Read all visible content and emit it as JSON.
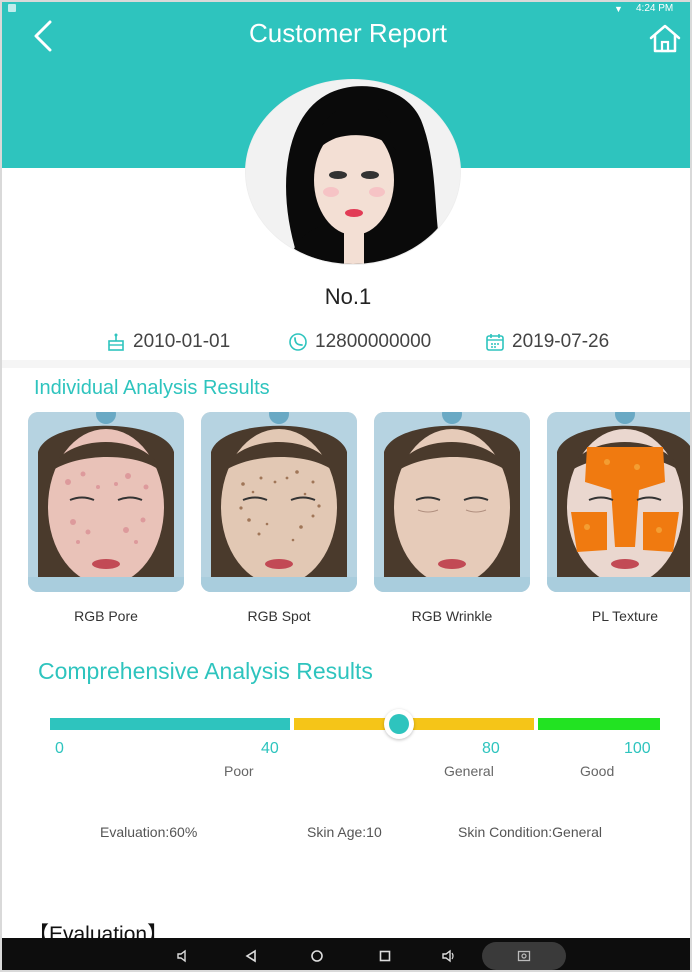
{
  "header": {
    "title": "Customer Report",
    "status_time": "4:24 PM",
    "color": "#2ec4be"
  },
  "customer": {
    "name": "No.1",
    "birthday": "2010-01-01",
    "phone": "12800000000",
    "report_date": "2019-07-26"
  },
  "individual": {
    "title": "Individual Analysis Results",
    "items": [
      {
        "label": "RGB Pore"
      },
      {
        "label": "RGB Spot"
      },
      {
        "label": "RGB Wrinkle"
      },
      {
        "label": "PL Texture"
      }
    ]
  },
  "comprehensive": {
    "title": "Comprehensive Analysis Results",
    "ticks": [
      "0",
      "40",
      "80",
      "100"
    ],
    "grades": [
      "Poor",
      "General",
      "Good"
    ],
    "indicator_value": 60,
    "segment_colors": [
      "#2ec4be",
      "#f5c518",
      "#22e322"
    ]
  },
  "summary": {
    "evaluation": "Evaluation:60%",
    "skin_age": "Skin Age:10",
    "skin_condition": "Skin Condition:General"
  },
  "evaluation_heading": "【Evaluation】",
  "nav_icons": [
    "volume-down-icon",
    "back-triangle-icon",
    "home-circle-icon",
    "recents-square-icon",
    "volume-up-icon",
    "screenshot-icon"
  ]
}
